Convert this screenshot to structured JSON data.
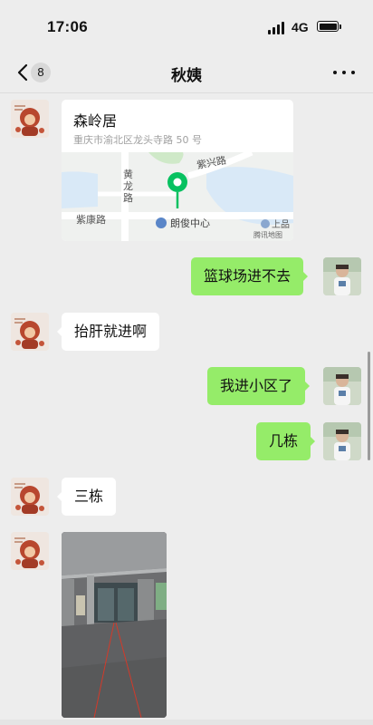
{
  "status_bar": {
    "time": "17:06",
    "network": "4G"
  },
  "nav": {
    "unread_count": "8",
    "title": "秋姨"
  },
  "location_card": {
    "name": "森岭居",
    "address": "重庆市渝北区龙头寺路 50 号",
    "map_labels": {
      "road_1": "紫兴路",
      "road_2_line1": "黄",
      "road_2_line2": "龙",
      "road_2_line3": "路",
      "road_3": "紫康路",
      "poi": "朗俊中心",
      "poi_2": "上品",
      "map_provider": "腾讯地图"
    }
  },
  "messages": {
    "m2": "篮球场进不去",
    "m3": "抬肝就进啊",
    "m4": "我进小区了",
    "m5": "几栋",
    "m6": "三栋"
  },
  "colors": {
    "outgoing_bubble": "#95ec69",
    "incoming_bubble": "#ffffff",
    "background": "#ededed",
    "pin": "#07c160"
  }
}
